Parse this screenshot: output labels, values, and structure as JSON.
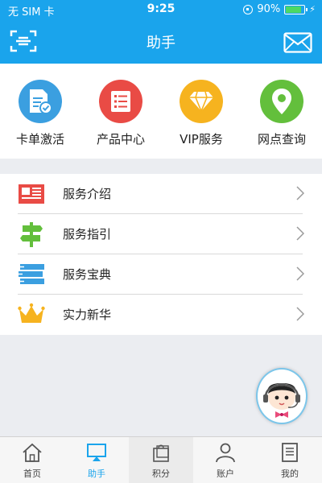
{
  "status_bar": {
    "carrier": "无 SIM 卡",
    "time": "9:25",
    "battery": "90%",
    "battery_level": 0.9
  },
  "nav": {
    "title": "助手",
    "left_icon": "scan-icon",
    "right_icon": "mail-icon"
  },
  "quick_links": [
    {
      "label": "卡单激活",
      "icon": "card-activate-icon",
      "color": "#3b9fe0"
    },
    {
      "label": "产品中心",
      "icon": "product-list-icon",
      "color": "#e94b45"
    },
    {
      "label": "VIP服务",
      "icon": "diamond-icon",
      "color": "#f6b31f"
    },
    {
      "label": "网点查询",
      "icon": "location-pin-icon",
      "color": "#63bf3c"
    }
  ],
  "menu": [
    {
      "label": "服务介绍",
      "icon": "newspaper-icon"
    },
    {
      "label": "服务指引",
      "icon": "signpost-icon"
    },
    {
      "label": "服务宝典",
      "icon": "books-icon"
    },
    {
      "label": "实力新华",
      "icon": "crown-icon"
    }
  ],
  "assistant": {
    "icon": "customer-service-avatar-icon"
  },
  "tabs": [
    {
      "label": "首页",
      "icon": "home-icon"
    },
    {
      "label": "助手",
      "icon": "assistant-icon",
      "selected": true
    },
    {
      "label": "积分",
      "icon": "shopping-bag-icon"
    },
    {
      "label": "账户",
      "icon": "person-icon"
    },
    {
      "label": "我的",
      "icon": "document-icon"
    }
  ],
  "colors": {
    "primary": "#1aa4ec",
    "background": "#ebedf1"
  }
}
